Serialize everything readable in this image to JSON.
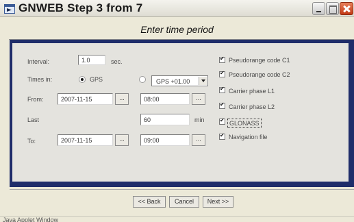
{
  "window": {
    "title": "GNWEB Step 3 from 7"
  },
  "heading": "Enter time period",
  "form": {
    "interval_label": "Interval:",
    "interval_value": "1.0",
    "interval_unit": "sec.",
    "times_in_label": "Times in:",
    "gps_option": "GPS",
    "tz_selected": "GPS +01.00",
    "from_label": "From:",
    "from_date": "2007-11-15",
    "from_time": "08:00",
    "last_label": "Last",
    "last_value": "60",
    "last_unit": "min",
    "to_label": "To:",
    "to_date": "2007-11-15",
    "to_time": "09:00",
    "ellipsis": "..."
  },
  "options": [
    {
      "label": "Pseudorange code C1",
      "checked": true
    },
    {
      "label": "Pseudorange code C2",
      "checked": true
    },
    {
      "label": "Carrier phase L1",
      "checked": true
    },
    {
      "label": "Carrier phase L2",
      "checked": true
    },
    {
      "label": "GLONASS",
      "checked": true
    },
    {
      "label": "Navigation file",
      "checked": true
    }
  ],
  "nav": {
    "back": "<< Back",
    "cancel": "Cancel",
    "next": "Next >>"
  },
  "status": "Java Applet Window"
}
